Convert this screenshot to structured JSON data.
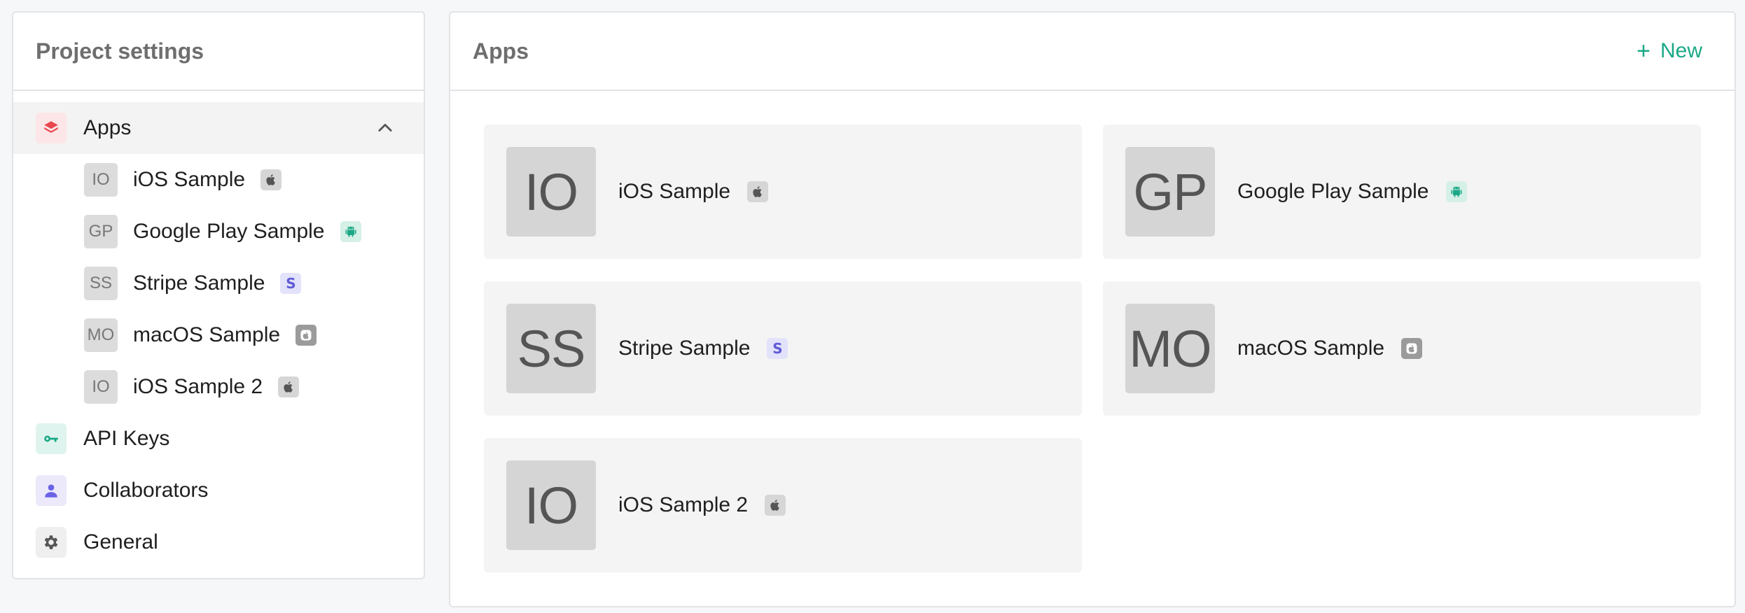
{
  "sidebar": {
    "title": "Project settings",
    "apps": {
      "label": "Apps",
      "items": [
        {
          "initials": "IO",
          "label": "iOS Sample",
          "platform": "apple-icon"
        },
        {
          "initials": "GP",
          "label": "Google Play Sample",
          "platform": "android-icon"
        },
        {
          "initials": "SS",
          "label": "Stripe Sample",
          "platform": "stripe-icon",
          "glyph": "S"
        },
        {
          "initials": "MO",
          "label": "macOS Sample",
          "platform": "mac-icon"
        },
        {
          "initials": "IO",
          "label": "iOS Sample 2",
          "platform": "apple-icon"
        }
      ]
    },
    "api_keys": "API Keys",
    "collaborators": "Collaborators",
    "general": "General"
  },
  "main": {
    "title": "Apps",
    "new_label": "New",
    "new_icon": "+",
    "cards": [
      {
        "initials": "IO",
        "label": "iOS Sample",
        "platform": "apple-icon"
      },
      {
        "initials": "GP",
        "label": "Google Play Sample",
        "platform": "android-icon"
      },
      {
        "initials": "SS",
        "label": "Stripe Sample",
        "platform": "stripe-icon",
        "glyph": "S"
      },
      {
        "initials": "MO",
        "label": "macOS Sample",
        "platform": "mac-icon"
      },
      {
        "initials": "IO",
        "label": "iOS Sample 2",
        "platform": "apple-icon"
      }
    ]
  },
  "colors": {
    "accent": "#1aa886",
    "apps_icon": "#e8474f",
    "key_icon": "#1aa886",
    "user_icon": "#6b63e6",
    "stripe": "#5f5bd6"
  }
}
